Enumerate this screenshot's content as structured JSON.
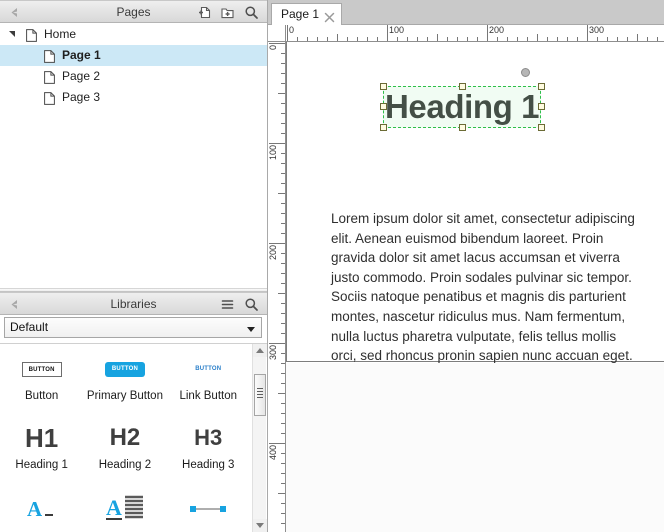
{
  "pages_panel": {
    "title": "Pages",
    "icons": {
      "collapse": "collapse-arrow-icon",
      "add_page": "add-page-icon",
      "add_folder": "add-folder-icon",
      "search": "search-icon"
    },
    "tree": [
      {
        "label": "Home",
        "depth": 0,
        "expanded": true,
        "selected": false
      },
      {
        "label": "Page 1",
        "depth": 1,
        "expanded": false,
        "selected": true
      },
      {
        "label": "Page 2",
        "depth": 1,
        "expanded": false,
        "selected": false
      },
      {
        "label": "Page 3",
        "depth": 1,
        "expanded": false,
        "selected": false
      }
    ]
  },
  "libraries_panel": {
    "title": "Libraries",
    "icons": {
      "collapse": "collapse-arrow-icon",
      "menu": "hamburger-menu-icon",
      "search": "search-icon"
    },
    "selected_library": "Default",
    "widgets": [
      {
        "name": "Button",
        "thumb": "button-outline-icon",
        "thumb_label": "BUTTON"
      },
      {
        "name": "Primary Button",
        "thumb": "button-primary-icon",
        "thumb_label": "BUTTON"
      },
      {
        "name": "Link Button",
        "thumb": "button-link-icon",
        "thumb_label": "BUTTON"
      },
      {
        "name": "Heading 1",
        "thumb": "h1-icon",
        "thumb_label": "H1"
      },
      {
        "name": "Heading 2",
        "thumb": "h2-icon",
        "thumb_label": "H2"
      },
      {
        "name": "Heading 3",
        "thumb": "h3-icon",
        "thumb_label": "H3"
      },
      {
        "name": "",
        "thumb": "label-icon",
        "thumb_label": ""
      },
      {
        "name": "",
        "thumb": "paragraph-icon",
        "thumb_label": ""
      },
      {
        "name": "",
        "thumb": "line-connector-icon",
        "thumb_label": ""
      }
    ]
  },
  "canvas": {
    "tab": {
      "label": "Page 1",
      "close_icon": "close-icon"
    },
    "ruler_h_labels": [
      "0",
      "100",
      "200",
      "300"
    ],
    "ruler_v_labels": [
      "0",
      "100",
      "200",
      "300",
      "400"
    ],
    "heading": {
      "text": "Heading 1",
      "selected": true,
      "selection_color": "#2fbf4a",
      "rotation_handle": "rotate-handle-icon"
    },
    "paragraph": {
      "text": "Lorem ipsum dolor sit amet, consectetur adipiscing elit. Aenean euismod bibendum laoreet. Proin gravida dolor sit amet lacus accumsan et viverra justo commodo. Proin sodales pulvinar sic tempor. Sociis natoque penatibus et magnis dis parturient montes, nascetur ridiculus mus. Nam fermentum, nulla luctus pharetra vulputate, felis tellus mollis orci, sed rhoncus pronin sapien nunc accuan eget."
    }
  },
  "theme": {
    "selection_row": "#cce8f6",
    "accent_blue": "#17a3e0",
    "link_blue": "#2a7fc9",
    "heading_gray": "#3f3f3f"
  }
}
